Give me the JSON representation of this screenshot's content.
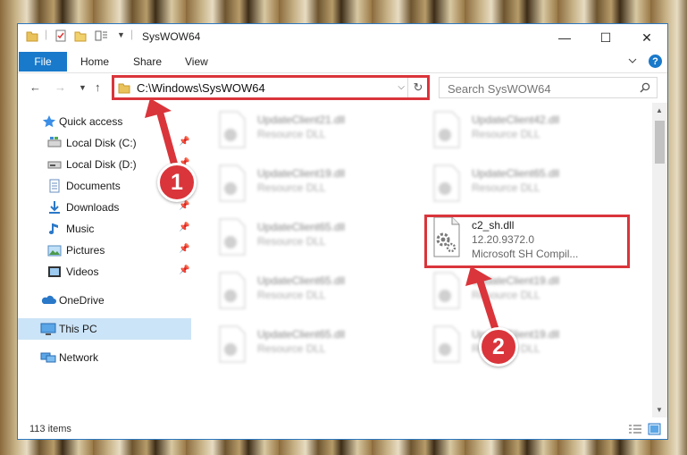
{
  "window": {
    "title": "SysWOW64",
    "controls": {
      "minimize": "—",
      "maximize": "☐",
      "close": "✕"
    }
  },
  "ribbon": {
    "file_tab": "File",
    "tabs": [
      "Home",
      "Share",
      "View"
    ],
    "help": "?"
  },
  "address": {
    "path": "C:\\Windows\\SysWOW64",
    "search_placeholder": "Search SysWOW64"
  },
  "nav_pane": {
    "quick_access": "Quick access",
    "items": [
      {
        "label": "Local Disk (C:)",
        "icon": "drive-icon",
        "pinned": true
      },
      {
        "label": "Local Disk (D:)",
        "icon": "drive-icon",
        "pinned": true
      },
      {
        "label": "Documents",
        "icon": "documents-icon",
        "pinned": true
      },
      {
        "label": "Downloads",
        "icon": "downloads-icon",
        "pinned": true
      },
      {
        "label": "Music",
        "icon": "music-icon",
        "pinned": true
      },
      {
        "label": "Pictures",
        "icon": "pictures-icon",
        "pinned": true
      },
      {
        "label": "Videos",
        "icon": "videos-icon",
        "pinned": true
      }
    ],
    "onedrive": "OneDrive",
    "this_pc": "This PC",
    "network": "Network"
  },
  "files": {
    "tiles": [
      {
        "name": "UpdateClient21.dll",
        "type": "Resource DLL"
      },
      {
        "name": "UpdateClient42.dll",
        "type": "Resource DLL"
      },
      {
        "name": "UpdateClient19.dll",
        "type": "Resource DLL"
      },
      {
        "name": "UpdateClient65.dll",
        "type": "Resource DLL"
      },
      {
        "name": "UpdateClient65.dll",
        "type": "Resource DLL"
      },
      {
        "name": "UpdateClient65.dll",
        "type": "Resource DLL"
      },
      {
        "name": "UpdateClient19.dll",
        "type": "Resource DLL"
      },
      {
        "name": "UpdateClient65.dll",
        "type": "Resource DLL"
      },
      {
        "name": "UpdateClient19.dll",
        "type": "Resource DLL"
      }
    ],
    "focus": {
      "name": "c2_sh.dll",
      "version": "12.20.9372.0",
      "description": "Microsoft SH Compil..."
    }
  },
  "status": {
    "item_count": "113 items"
  },
  "callouts": {
    "one": "1",
    "two": "2"
  },
  "colors": {
    "accent": "#1979ca",
    "highlight": "#d9353b",
    "selection": "#cce4f7"
  }
}
